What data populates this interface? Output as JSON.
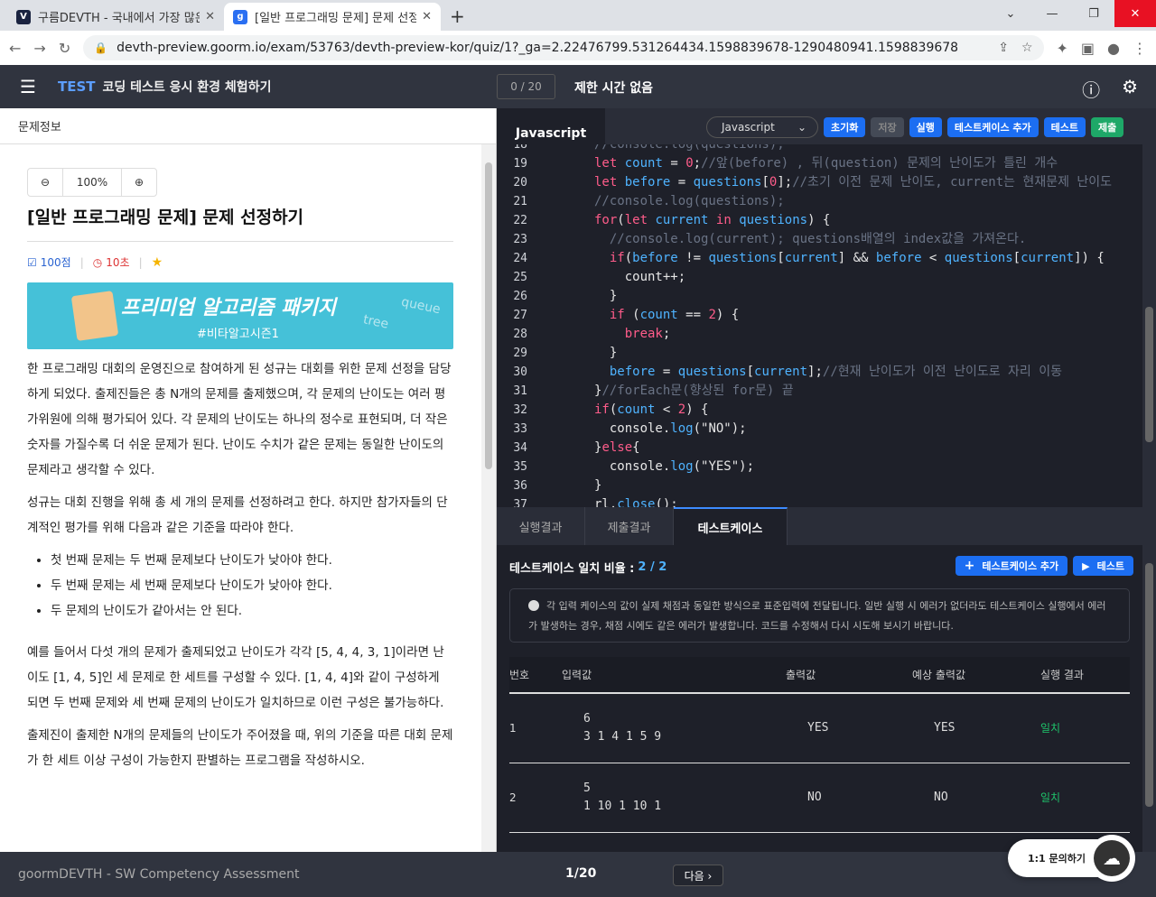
{
  "browser": {
    "tabs": [
      {
        "title": "구름DEVTH - 국내에서 가장 많은",
        "icon": "V"
      },
      {
        "title": "[일반 프로그래밍 문제] 문제 선정",
        "icon": "g"
      }
    ],
    "url": "devth-preview.goorm.io/exam/53763/devth-preview-kor/quiz/1?_ga=2.22476799.531264434.1598839678-1290480941.1598839678"
  },
  "appbar": {
    "tag": "TEST",
    "title": "코딩 테스트 응시 환경 체험하기",
    "counter": "0 / 20",
    "time_limit": "제한 시간 없음"
  },
  "left": {
    "header": "문제정보",
    "zoom": "100%",
    "problem_title": "[일반 프로그래밍 문제] 문제 선정하기",
    "score": "100점",
    "time": "10초",
    "banner_title": "프리미엄 알고리즘 패키지",
    "banner_sub": "#비타알고시즌1",
    "banner_w1": "queue",
    "banner_w2": "tree",
    "para1": "한 프로그래밍 대회의 운영진으로 참여하게 된 성규는 대회를 위한 문제 선정을 담당하게 되었다. 출제진들은 총 N개의 문제를 출제했으며, 각 문제의 난이도는 여러 평가위원에 의해 평가되어 있다. 각 문제의 난이도는 하나의 정수로 표현되며, 더 작은 숫자를 가질수록 더 쉬운 문제가 된다. 난이도 수치가 같은 문제는 동일한 난이도의 문제라고 생각할 수 있다.",
    "para2": "성규는 대회 진행을 위해 총 세 개의 문제를 선정하려고 한다. 하지만 참가자들의 단계적인 평가를 위해 다음과 같은 기준을 따라야 한다.",
    "bullets": [
      "첫 번째 문제는 두 번째 문제보다 난이도가 낮아야 한다.",
      "두 번째 문제는 세 번째 문제보다 난이도가 낮아야 한다.",
      "두 문제의 난이도가 같아서는 안 된다."
    ],
    "para3": "예를 들어서 다섯 개의 문제가 출제되었고 난이도가 각각 [5, 4, 4, 3, 1]이라면 난이도 [1, 4, 5]인 세 문제로 한 세트를 구성할 수 있다. [1, 4, 4]와 같이 구성하게 되면 두 번째 문제와 세 번째 문제의 난이도가 일치하므로 이런 구성은 불가능하다.",
    "para4": "출제진이 출제한 N개의 문제들의 난이도가 주어졌을 때, 위의 기준을 따른 대회 문제가 한 세트 이상 구성이 가능한지 판별하는 프로그램을 작성하시오."
  },
  "editor": {
    "lang_tab": "Javascript",
    "lang_select": "Javascript",
    "buttons": {
      "reset": "초기화",
      "save": "저장",
      "run": "실행",
      "add_tc": "테스트케이스 추가",
      "test": "테스트",
      "submit": "제출"
    },
    "lines": [
      {
        "n": "18",
        "html": "<span class=\"cm\">//console.log(questions);</span>"
      },
      {
        "n": "19",
        "html": "<span class=\"kw\">let</span> <span class=\"va\">count</span> = <span class=\"nu\">0</span>;<span class=\"cm\">//앞(before) , 뒤(question) 문제의 난이도가 틀린 개수</span>"
      },
      {
        "n": "20",
        "html": "<span class=\"kw\">let</span> <span class=\"va\">before</span> = <span class=\"va\">questions</span>[<span class=\"nu\">0</span>];<span class=\"cm\">//초기 이전 문제 난이도, current는 현재문제 난이도</span>"
      },
      {
        "n": "21",
        "html": "<span class=\"cm\">//console.log(questions);</span>"
      },
      {
        "n": "22",
        "html": "<span class=\"kw\">for</span>(<span class=\"kw\">let</span> <span class=\"va\">current</span> <span class=\"kw\">in</span> <span class=\"va\">questions</span>) {"
      },
      {
        "n": "23",
        "html": "  <span class=\"cm\">//console.log(current); questions배열의 index값을 가져온다.</span>"
      },
      {
        "n": "24",
        "html": "  <span class=\"kw\">if</span>(<span class=\"va\">before</span> != <span class=\"va\">questions</span>[<span class=\"va\">current</span>] && <span class=\"va\">before</span> < <span class=\"va\">questions</span>[<span class=\"va\">current</span>]) {"
      },
      {
        "n": "25",
        "html": "    count++;"
      },
      {
        "n": "26",
        "html": "  }"
      },
      {
        "n": "27",
        "html": "  <span class=\"kw\">if</span> (<span class=\"va\">count</span> == <span class=\"nu\">2</span>) {"
      },
      {
        "n": "28",
        "html": "    <span class=\"kw\">break</span>;"
      },
      {
        "n": "29",
        "html": "  }"
      },
      {
        "n": "30",
        "html": "  <span class=\"va\">before</span> = <span class=\"va\">questions</span>[<span class=\"va\">current</span>];<span class=\"cm\">//현재 난이도가 이전 난이도로 자리 이동</span>"
      },
      {
        "n": "31",
        "html": "}<span class=\"cm\">//forEach문(향상된 for문) 끝</span>"
      },
      {
        "n": "32",
        "html": "<span class=\"kw\">if</span>(<span class=\"va\">count</span> < <span class=\"nu\">2</span>) {"
      },
      {
        "n": "33",
        "html": "  console.<span class=\"va\">log</span>(\"NO\");"
      },
      {
        "n": "34",
        "html": "}<span class=\"kw\">else</span>{"
      },
      {
        "n": "35",
        "html": "  console.<span class=\"va\">log</span>(\"YES\");"
      },
      {
        "n": "36",
        "html": "}"
      },
      {
        "n": "37",
        "html": "rl.<span class=\"va\">close</span>();"
      }
    ]
  },
  "results": {
    "tabs": [
      "실행결과",
      "제출결과",
      "테스트케이스"
    ],
    "match_label": "테스트케이스 일치 비율 :",
    "match_ratio": "2 / 2",
    "add_tc": "테스트케이스 추가",
    "test": "테스트",
    "notice": "각 입력 케이스의 값이 실제 채점과 동일한 방식으로 표준입력에 전달됩니다. 일반 실행 시 에러가 없더라도 테스트케이스 실행에서 에러가 발생하는 경우, 채점 시에도 같은 에러가 발생합니다. 코드를 수정해서 다시 시도해 보시기 바랍니다.",
    "columns": [
      "번호",
      "입력값",
      "출력값",
      "예상 출력값",
      "실행 결과"
    ],
    "rows": [
      {
        "no": "1",
        "input": "6\n3 1 4 1 5 9",
        "output": "YES",
        "expected": "YES",
        "result": "일치"
      },
      {
        "no": "2",
        "input": "5\n1 10 1 10 1",
        "output": "NO",
        "expected": "NO",
        "result": "일치"
      }
    ]
  },
  "footer": {
    "brand": "goormDEVTH - SW Competency Assessment",
    "page": "1/20",
    "next": "다음 ›",
    "chat": "1:1 문의하기"
  }
}
